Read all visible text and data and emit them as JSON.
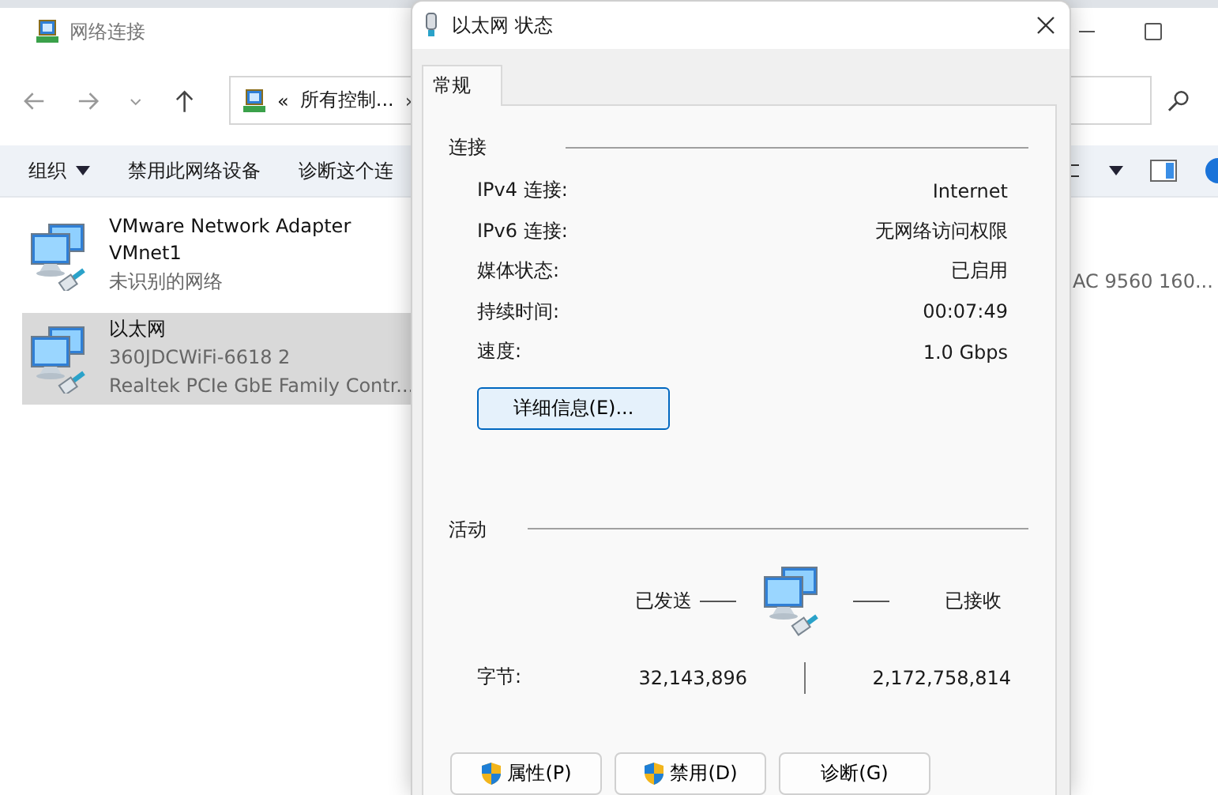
{
  "explorer": {
    "title": "网络连接",
    "address": {
      "prefix": "«",
      "path": "所有控制...",
      "separator": "›"
    },
    "toolbar": [
      {
        "label": "组织",
        "kind": "menu"
      },
      {
        "label": "禁用此网络设备",
        "kind": "action"
      },
      {
        "label": "诊断这个连",
        "kind": "action"
      }
    ],
    "adapters": [
      {
        "name": "VMware Network Adapter VMnet1",
        "network": "未识别的网络",
        "selected": false
      },
      {
        "name": "以太网",
        "network": "360JDCWiFi-6618 2",
        "device": "Realtek PCIe GbE Family Contr...",
        "selected": true
      }
    ],
    "partial_adapter_device": "AC 9560 160..."
  },
  "dialog": {
    "title": "以太网 状态",
    "tabs": [
      {
        "label": "常规",
        "selected": true
      }
    ],
    "connection": {
      "heading": "连接",
      "rows": [
        {
          "label": "IPv4 连接:",
          "value": "Internet"
        },
        {
          "label": "IPv6 连接:",
          "value": "无网络访问权限"
        },
        {
          "label": "媒体状态:",
          "value": "已启用"
        },
        {
          "label": "持续时间:",
          "value": "00:07:49"
        },
        {
          "label": "速度:",
          "value": "1.0 Gbps"
        }
      ]
    },
    "details_button": "详细信息(E)...",
    "activity": {
      "heading": "活动",
      "sent_label": "已发送",
      "received_label": "已接收",
      "bytes_label": "字节:",
      "bytes_sent": "32,143,896",
      "bytes_received": "2,172,758,814"
    },
    "buttons": [
      {
        "label": "属性(P)",
        "shield": true
      },
      {
        "label": "禁用(D)",
        "shield": true
      },
      {
        "label": "诊断(G)",
        "shield": false
      }
    ]
  }
}
